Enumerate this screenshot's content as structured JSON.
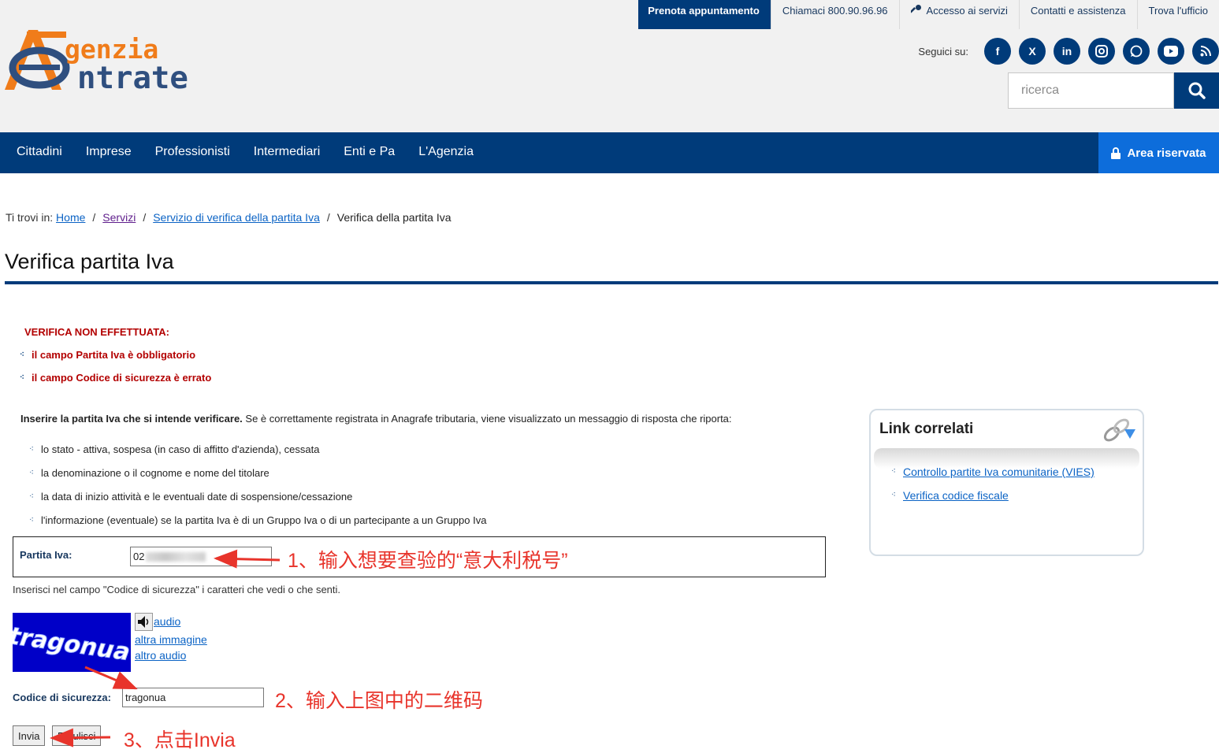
{
  "header": {
    "logo_text": "Agenzia Entrate",
    "top_links": [
      {
        "label": "Prenota appuntamento"
      },
      {
        "label": "Chiamaci 800.90.96.96"
      },
      {
        "label": "Accesso ai servizi"
      },
      {
        "label": "Contatti e assistenza"
      },
      {
        "label": "Trova l'ufficio"
      }
    ],
    "social_label": "Seguici su:",
    "social_icons": [
      "facebook-icon",
      "x-icon",
      "linkedin-icon",
      "instagram-icon",
      "whatsapp-icon",
      "youtube-icon",
      "rss-icon"
    ],
    "search_placeholder": "ricerca"
  },
  "nav": {
    "items": [
      "Cittadini",
      "Imprese",
      "Professionisti",
      "Intermediari",
      "Enti e Pa",
      "L'Agenzia"
    ],
    "area_riservata": "Area riservata"
  },
  "breadcrumb": {
    "prefix": "Ti trovi in:",
    "items": [
      "Home",
      "Servizi",
      "Servizio di verifica della partita Iva"
    ],
    "current": "Verifica della partita Iva"
  },
  "page_title": "Verifica partita Iva",
  "errors": {
    "heading": "VERIFICA NON EFFETTUATA:",
    "items": [
      "il campo Partita Iva è obbligatorio",
      "il campo Codice di sicurezza è errato"
    ]
  },
  "intro": {
    "bold": "Inserire la partita Iva che si intende verificare.",
    "rest": " Se è correttamente registrata in Anagrafe tributaria, viene visualizzato un messaggio di risposta che riporta:"
  },
  "info_list": [
    "lo stato - attiva, sospesa (in caso di affitto d'azienda), cessata",
    "la denominazione o il cognome e nome del titolare",
    "la data di inizio attività e le eventuali date di sospensione/cessazione",
    "l'informazione (eventuale) se la partita Iva è di un Gruppo Iva o di un partecipante a un Gruppo Iva"
  ],
  "form": {
    "partita_label": "Partita Iva:",
    "partita_value": "02",
    "hint": "Inserisci nel campo \"Codice di sicurezza\" i caratteri che vedi o che senti.",
    "captcha_text": "tragonua",
    "audio_link": "audio",
    "other_image_link": "altra immagine",
    "other_audio_link": "altro audio",
    "code_label": "Codice di sicurezza:",
    "code_value": "tragonua",
    "submit_label": "Invia",
    "reset_label": "Ripulisci"
  },
  "annotations": {
    "step1": "1、输入想要查验的“意大利税号”",
    "step2": "2、输入上图中的二维码",
    "step3": "3、点击Invia"
  },
  "sidebar": {
    "title": "Link correlati",
    "links": [
      "Controllo partite Iva comunitarie (VIES)",
      "Verifica codice fiscale"
    ]
  },
  "colors": {
    "brand_blue": "#003b7a",
    "accent_blue": "#0d6ddb",
    "error_red": "#b30000",
    "annotation_red": "#e8342b",
    "logo_orange": "#f07c1a"
  }
}
